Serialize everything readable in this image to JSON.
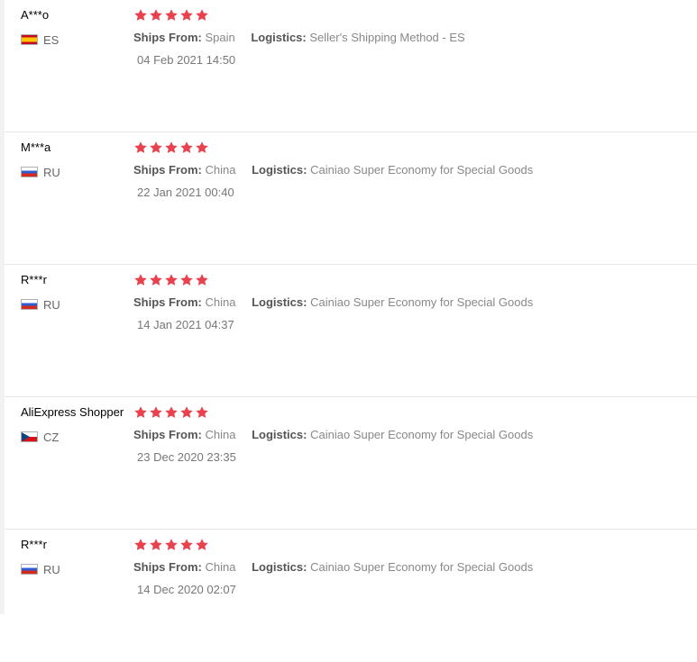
{
  "colors": {
    "star": "#e8424e",
    "label": "#555555",
    "value": "#888888"
  },
  "labels": {
    "ships_from": "Ships From:",
    "logistics": "Logistics:"
  },
  "reviews": [
    {
      "reviewer": "A***o",
      "country": "ES",
      "flag": "spain-flag-icon",
      "rating": 5,
      "ships_from": "Spain",
      "logistics": "Seller's Shipping Method - ES",
      "date": "04 Feb 2021 14:50"
    },
    {
      "reviewer": "M***a",
      "country": "RU",
      "flag": "russia-flag-icon",
      "rating": 5,
      "ships_from": "China",
      "logistics": "Cainiao Super Economy for Special Goods",
      "date": "22 Jan 2021 00:40"
    },
    {
      "reviewer": "R***r",
      "country": "RU",
      "flag": "russia-flag-icon",
      "rating": 5,
      "ships_from": "China",
      "logistics": "Cainiao Super Economy for Special Goods",
      "date": "14 Jan 2021 04:37"
    },
    {
      "reviewer": "AliExpress Shopper",
      "country": "CZ",
      "flag": "czech-flag-icon",
      "rating": 5,
      "ships_from": "China",
      "logistics": "Cainiao Super Economy for Special Goods",
      "date": "23 Dec 2020 23:35"
    },
    {
      "reviewer": "R***r",
      "country": "RU",
      "flag": "russia-flag-icon",
      "rating": 5,
      "ships_from": "China",
      "logistics": "Cainiao Super Economy for Special Goods",
      "date": "14 Dec 2020 02:07"
    }
  ]
}
